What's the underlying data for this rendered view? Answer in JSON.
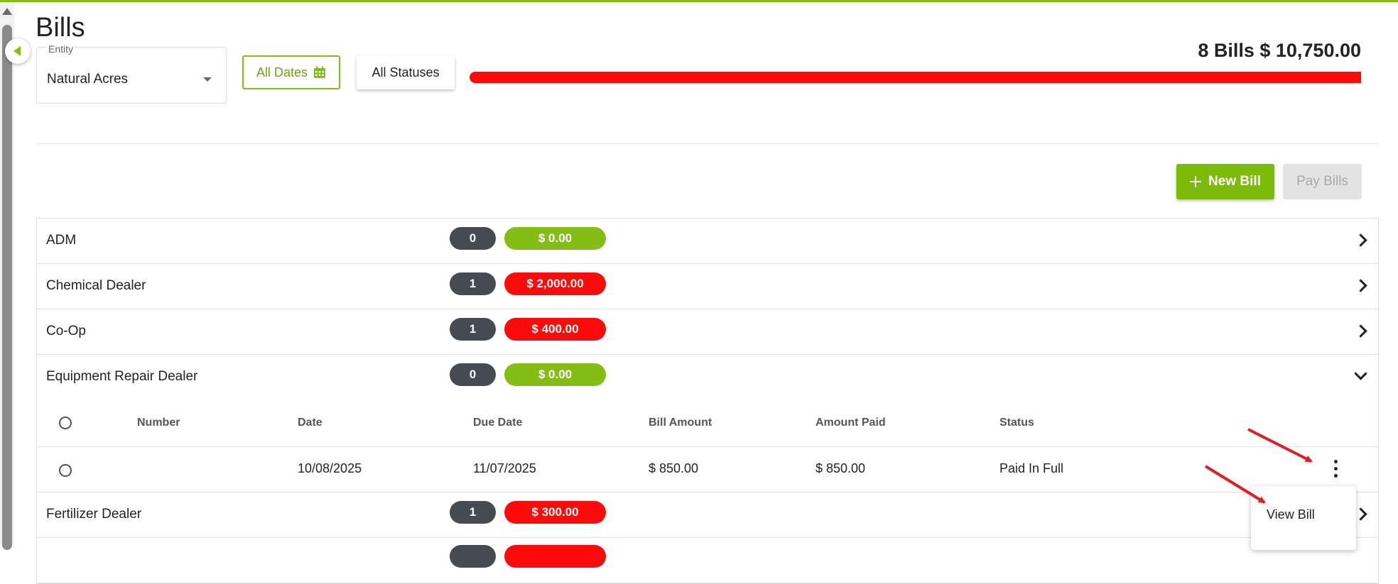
{
  "page": {
    "title": "Bills"
  },
  "filters": {
    "entity_label": "Entity",
    "entity_value": "Natural Acres",
    "dates_label": "All Dates",
    "status_label": "All Statuses"
  },
  "summary": {
    "text": "8 Bills $ 10,750.00",
    "progress_fraction": 1.0,
    "progress_color": "#ff0a0a"
  },
  "actions": {
    "new_bill": "New Bill",
    "pay_bills": "Pay Bills"
  },
  "colors": {
    "accent": "#7cbb0a",
    "amount_zero": "#84bd14",
    "amount_due": "#ff0a0a",
    "count_pill": "#454b52"
  },
  "vendors": [
    {
      "name": "ADM",
      "count": "0",
      "amount": "$ 0.00",
      "status": "zero",
      "expanded": false
    },
    {
      "name": "Chemical Dealer",
      "count": "1",
      "amount": "$ 2,000.00",
      "status": "due",
      "expanded": false
    },
    {
      "name": "Co-Op",
      "count": "1",
      "amount": "$ 400.00",
      "status": "due",
      "expanded": false
    },
    {
      "name": "Equipment Repair Dealer",
      "count": "0",
      "amount": "$ 0.00",
      "status": "zero",
      "expanded": true
    },
    {
      "name": "Fertilizer Dealer",
      "count": "1",
      "amount": "$ 300.00",
      "status": "due",
      "expanded": false
    }
  ],
  "bills_table": {
    "columns": [
      "Number",
      "Date",
      "Due Date",
      "Bill Amount",
      "Amount Paid",
      "Status"
    ],
    "rows": [
      {
        "number": "",
        "date": "10/08/2025",
        "due_date": "11/07/2025",
        "bill_amount": "$ 850.00",
        "amount_paid": "$ 850.00",
        "status": "Paid In Full"
      }
    ]
  },
  "row_menu": {
    "items": [
      "View Bill"
    ]
  }
}
